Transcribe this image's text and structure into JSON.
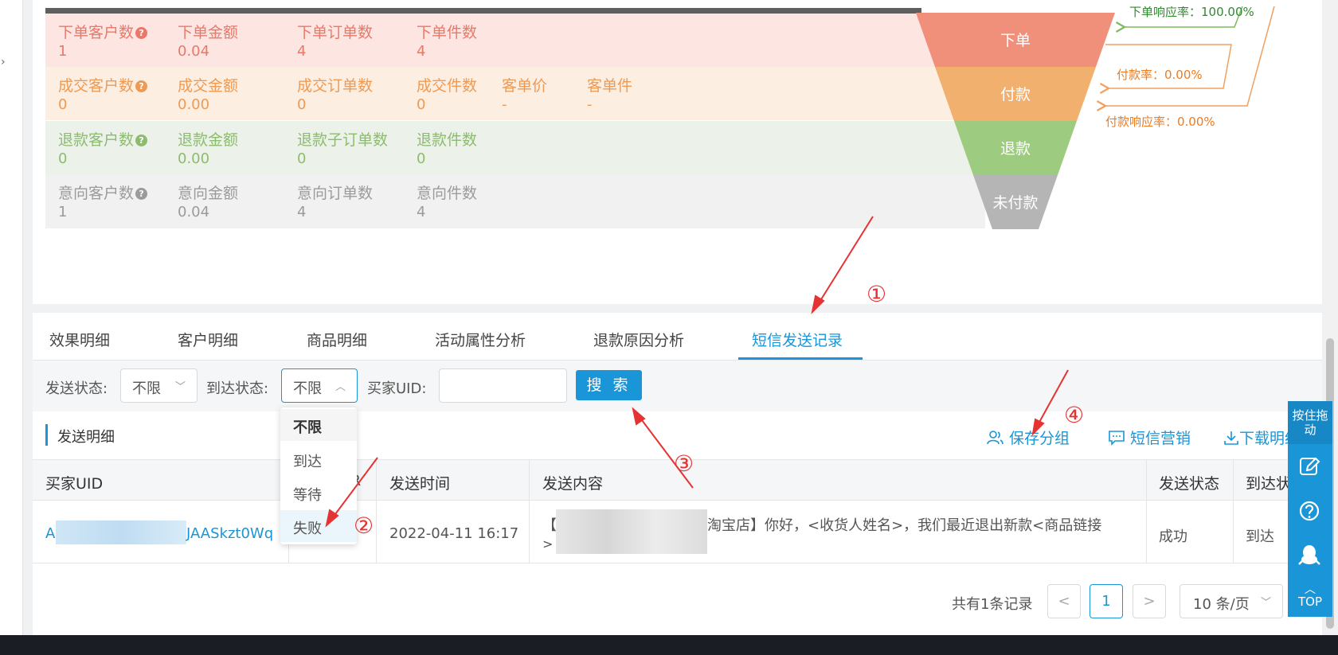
{
  "metrics": {
    "order": [
      {
        "label": "下单客户数",
        "value": "1",
        "help": true
      },
      {
        "label": "下单金额",
        "value": "0.04"
      },
      {
        "label": "下单订单数",
        "value": "4"
      },
      {
        "label": "下单件数",
        "value": "4"
      }
    ],
    "paid": [
      {
        "label": "成交客户数",
        "value": "0",
        "help": true
      },
      {
        "label": "成交金额",
        "value": "0.00"
      },
      {
        "label": "成交订单数",
        "value": "0"
      },
      {
        "label": "成交件数",
        "value": "0"
      },
      {
        "label": "客单价",
        "value": "-"
      },
      {
        "label": "客单件",
        "value": "-"
      }
    ],
    "refund": [
      {
        "label": "退款客户数",
        "value": "0",
        "help": true
      },
      {
        "label": "退款金额",
        "value": "0.00"
      },
      {
        "label": "退款子订单数",
        "value": "0"
      },
      {
        "label": "退款件数",
        "value": "0"
      }
    ],
    "intent": [
      {
        "label": "意向客户数",
        "value": "1",
        "help": true
      },
      {
        "label": "意向金额",
        "value": "0.04"
      },
      {
        "label": "意向订单数",
        "value": "4"
      },
      {
        "label": "意向件数",
        "value": "4"
      }
    ]
  },
  "funnel": {
    "stages": [
      "下单",
      "付款",
      "退款",
      "未付款"
    ],
    "colors": [
      "#f0907a",
      "#f1b06e",
      "#9dcb7f",
      "#b5b5b5"
    ],
    "rates": {
      "order_response": "下单响应率：100.00%",
      "pay": "付款率：0.00%",
      "pay_response": "付款响应率：0.00%"
    }
  },
  "tabs": [
    "效果明细",
    "客户明细",
    "商品明细",
    "活动属性分析",
    "退款原因分析",
    "短信发送记录"
  ],
  "active_tab": "短信发送记录",
  "filters": {
    "send_status_label": "发送状态:",
    "send_status_value": "不限",
    "arrive_status_label": "到达状态:",
    "arrive_status_value": "不限",
    "uid_label": "买家UID:",
    "uid_value": "",
    "search_button": "搜 索"
  },
  "dropdown_options": [
    "不限",
    "到达",
    "等待",
    "失败"
  ],
  "section": {
    "title": "发送明细",
    "actions": {
      "save_group": "保存分组",
      "sms_marketing": "短信营销",
      "download": "下载明细"
    }
  },
  "table": {
    "columns": [
      "买家UID",
      "R",
      "发送时间",
      "发送内容",
      "发送状态",
      "到达状态"
    ],
    "rows": [
      {
        "uid_prefix": "A",
        "uid_suffix": "JAASkzt0Wq",
        "send_time": "2022-04-11 16:17",
        "content_prefix": "【",
        "content_line1": "淘宝店】你好，<收货人姓名>，我们最近退出新款<商品链接",
        "content_line2": ">",
        "send_status": "成功",
        "arrive_status": "到达"
      }
    ]
  },
  "pagination": {
    "total": "共有1条记录",
    "current_page": "1",
    "page_size": "10 条/页"
  },
  "sidebar": {
    "drag_label": "按住拖动",
    "top_label": "TOP"
  },
  "annotations": [
    "①",
    "②",
    "③",
    "④"
  ]
}
